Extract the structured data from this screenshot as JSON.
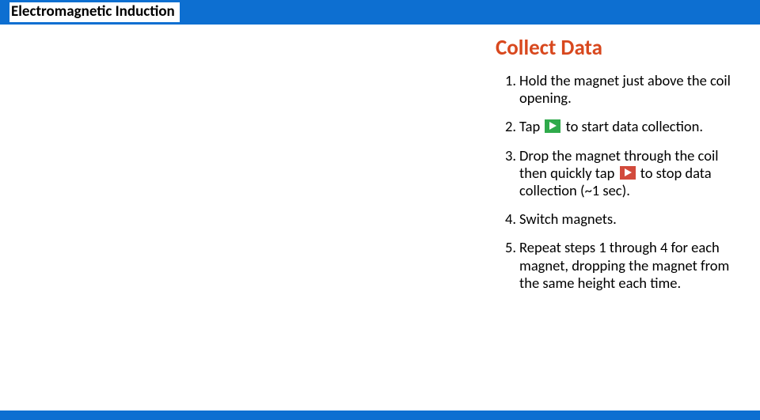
{
  "header": {
    "title": "Electromagnetic Induction"
  },
  "section_title": "Collect Data",
  "steps": [
    {
      "num": "1.",
      "pre": "Hold the magnet just above the coil opening."
    },
    {
      "num": "2.",
      "pre": "Tap",
      "icon": "play",
      "post": "to start data collection."
    },
    {
      "num": "3.",
      "pre": "Drop the magnet through the coil then quickly tap",
      "icon": "stop",
      "post": "to stop data collection (~1 sec)."
    },
    {
      "num": "4.",
      "pre": "Switch magnets."
    },
    {
      "num": "5.",
      "pre": "Repeat steps 1 through 4 for each magnet, dropping the magnet from the same height each time."
    }
  ]
}
